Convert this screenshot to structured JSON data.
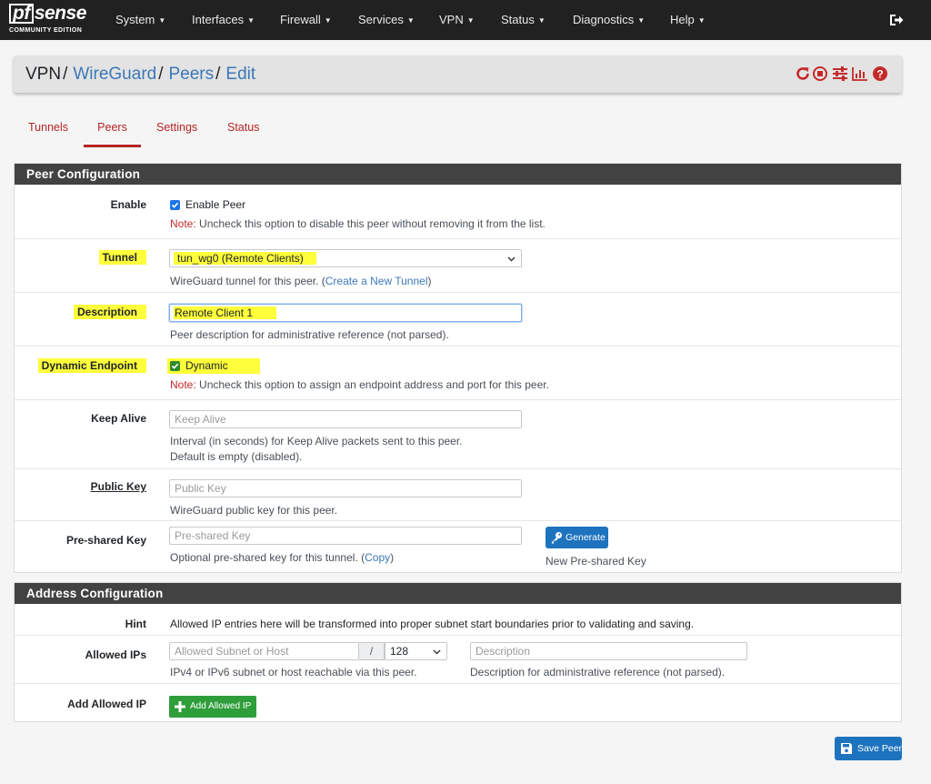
{
  "navbar": {
    "logo_main": "sense",
    "logo_pf": "pf",
    "logo_sub": "COMMUNITY EDITION",
    "menu": [
      "System",
      "Interfaces",
      "Firewall",
      "Services",
      "VPN",
      "Status",
      "Diagnostics",
      "Help"
    ],
    "logout_icon": "sign-out-icon"
  },
  "breadcrumb": {
    "items": [
      "VPN",
      "WireGuard",
      "Peers",
      "Edit"
    ],
    "separator": "/",
    "icons": [
      "reload-icon",
      "stop-icon",
      "sliders-icon",
      "chart-icon",
      "help-icon"
    ],
    "icon_color": "#c52a2a"
  },
  "tabs": [
    {
      "label": "Tunnels",
      "active": false
    },
    {
      "label": "Peers",
      "active": true
    },
    {
      "label": "Settings",
      "active": false
    },
    {
      "label": "Status",
      "active": false
    }
  ],
  "peer_config": {
    "title": "Peer Configuration",
    "enable": {
      "label": "Enable",
      "checkbox_label": "Enable Peer",
      "checked": true,
      "note_prefix": "Note:",
      "note": " Uncheck this option to disable this peer without removing it from the list."
    },
    "tunnel": {
      "label": "Tunnel",
      "value": "tun_wg0 (Remote Clients)",
      "help": "WireGuard tunnel for this peer. (",
      "help_link": "Create a New Tunnel",
      "help_end": ")"
    },
    "description": {
      "label": "Description",
      "value": "Remote Client 1",
      "help": "Peer description for administrative reference (not parsed)."
    },
    "dynamic_endpoint": {
      "label": "Dynamic Endpoint",
      "checkbox_label": "Dynamic",
      "checked": true,
      "note_prefix": "Note:",
      "note": " Uncheck this option to assign an endpoint address and port for this peer."
    },
    "keep_alive": {
      "label": "Keep Alive",
      "placeholder": "Keep Alive",
      "help_line1": "Interval (in seconds) for Keep Alive packets sent to this peer.",
      "help_line2": "Default is empty (disabled)."
    },
    "public_key": {
      "label": "Public Key",
      "placeholder": "Public Key",
      "help": "WireGuard public key for this peer."
    },
    "preshared_key": {
      "label": "Pre-shared Key",
      "placeholder": "Pre-shared Key",
      "help": "Optional pre-shared key for this tunnel. (",
      "help_link": "Copy",
      "help_end": ")",
      "generate_label": "Generate",
      "generate_help": "New Pre-shared Key"
    }
  },
  "address_config": {
    "title": "Address Configuration",
    "hint": {
      "label": "Hint",
      "text": "Allowed IP entries here will be transformed into proper subnet start boundaries prior to validating and saving."
    },
    "allowed_ips": {
      "label": "Allowed IPs",
      "subnet_placeholder": "Allowed Subnet or Host",
      "slash": "/",
      "mask": "128",
      "desc_placeholder": "Description",
      "subnet_help": "IPv4 or IPv6 subnet or host reachable via this peer.",
      "desc_help": "Description for administrative reference (not parsed)."
    },
    "add_allowed_ip": {
      "label": "Add Allowed IP",
      "button": "Add Allowed IP"
    }
  },
  "save_button": "Save Peer",
  "colors": {
    "navbar": "#212121",
    "panel_head": "#424242",
    "accent_red": "#b52525",
    "link_blue": "#3b78b8",
    "highlight": "#ffff3b",
    "primary_button": "#1e73be",
    "success_button": "#2e9e3a"
  }
}
